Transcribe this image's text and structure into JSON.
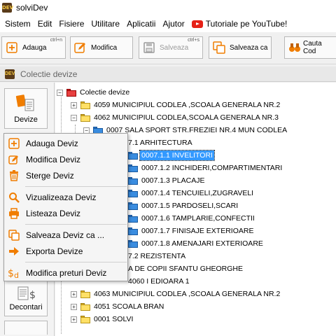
{
  "window": {
    "title": "solviDev",
    "app_icon_text": "DEV"
  },
  "menubar": {
    "items": [
      "Sistem",
      "Edit",
      "Fisiere",
      "Utilitare",
      "Aplicatii",
      "Ajutor"
    ],
    "youtube_label": "Tutoriale pe YouTube!"
  },
  "toolbar": {
    "add": {
      "label": "Adauga",
      "shortcut": "ctrl+n"
    },
    "edit": {
      "label": "Modifica"
    },
    "save": {
      "label": "Salveaza",
      "shortcut": "ctrl+s"
    },
    "save_as": {
      "label": "Salveaza ca"
    },
    "search": {
      "label": "Cauta Cod"
    }
  },
  "panel": {
    "title": "Colectie devize"
  },
  "sidebar": {
    "devize_label": "Devize",
    "decontari_label": "Decontari"
  },
  "tree": {
    "root": "Colectie devize",
    "rows": [
      "4059  MUNICIPIUL CODLEA ,SCOALA GENERALA NR.2",
      "4062  MUNICIPIUL CODLEA,SCOALA GENERALA NR.3",
      "0007 SALA SPORT STR.FREZIEI NR.4 MUN CODLEA",
      "7.1 ARHITECTURA",
      "0007.1.1 INVELITORI",
      "0007.1.2 INCHIDERI,COMPARTIMENTARI",
      "0007.1.3 PLACAJE",
      "0007.1.4 TENCUIELI,ZUGRAVELI",
      "0007.1.5 PARDOSELI,SCARI",
      "0007.1.6 TAMPLARIE,CONFECTII",
      "0007.1.7 FINISAJE EXTERIOARE",
      "0007.1.8 AMENAJARI EXTERIOARE",
      "7.2 REZISTENTA",
      "A DE COPII SFANTU GHEORGHE",
      "4060 I EDIOARA 1",
      "4063 MUNICIPIUL CODLEA ,SCOALA GENERALA NR.2",
      "4051 SCOALA  BRAN",
      "0001 SOLVI"
    ]
  },
  "context_menu": {
    "items": [
      "Adauga Deviz",
      "Modifica Deviz",
      "Sterge Deviz",
      "Vizualizeaza Deviz",
      "Listeaza Deviz",
      "Salveaza Deviz ca ...",
      "Exporta Devize",
      "Modifica preturi Deviz"
    ]
  },
  "colors": {
    "accent_orange": "#f07d00",
    "selection": "#3399ff",
    "youtube_red": "#e62117"
  }
}
